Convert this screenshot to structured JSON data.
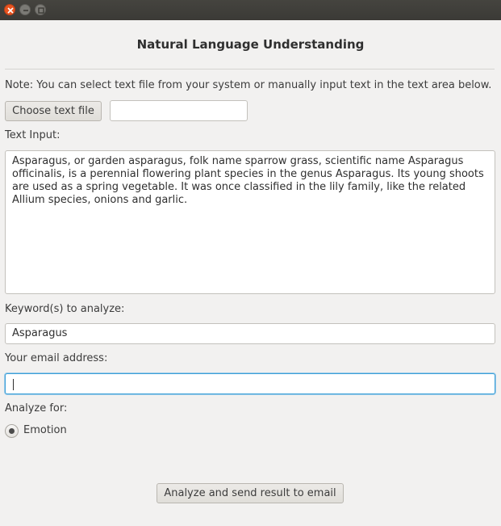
{
  "window": {
    "controls": {
      "close_icon": "close-icon",
      "minimize_icon": "minimize-icon",
      "maximize_icon": "maximize-icon"
    }
  },
  "header": {
    "title": "Natural Language Understanding"
  },
  "note": "Note: You can select text file from your system or manually input text in the text area below.",
  "file": {
    "choose_label": "Choose text file",
    "path_value": ""
  },
  "text_input": {
    "label": "Text Input:",
    "value": "Asparagus, or garden asparagus, folk name sparrow grass, scientific name Asparagus officinalis, is a perennial flowering plant species in the genus Asparagus. Its young shoots are used as a spring vegetable. It was once classified in the lily family, like the related Allium species, onions and garlic."
  },
  "keywords": {
    "label": "Keyword(s) to analyze:",
    "value": "Asparagus"
  },
  "email": {
    "label": "Your email address:",
    "value": ""
  },
  "analyze_for": {
    "label": "Analyze for:",
    "options": [
      {
        "label": "Emotion",
        "selected": true
      }
    ]
  },
  "actions": {
    "analyze_label": "Analyze and send result to email"
  },
  "colors": {
    "titlebar": "#3b3a36",
    "close": "#e95420",
    "focus": "#3b9fd8",
    "background": "#f2f1f0"
  }
}
